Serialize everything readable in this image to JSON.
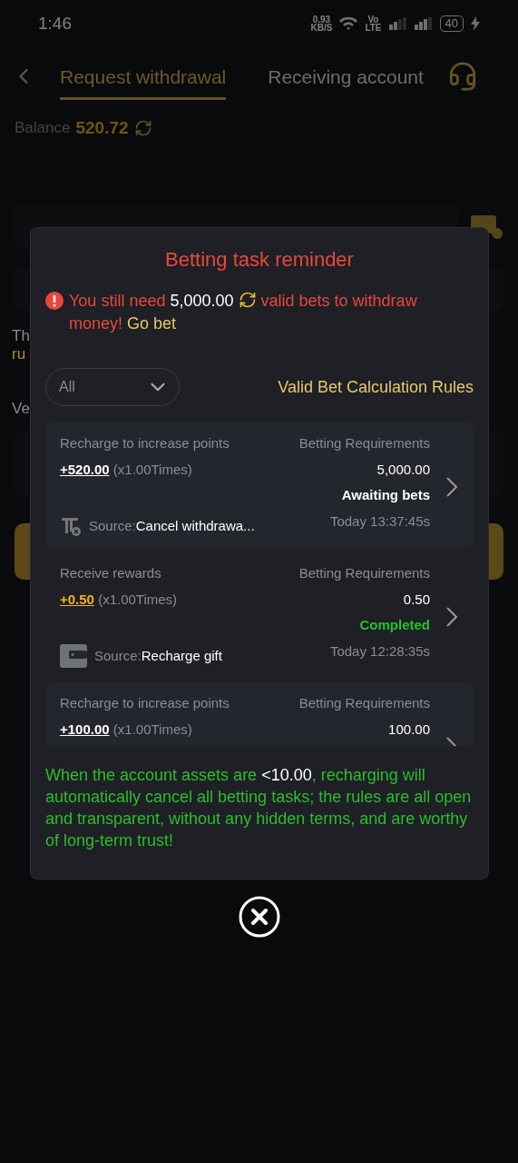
{
  "status_bar": {
    "time": "1:46",
    "net_speed": "0.93",
    "net_unit": "KB/S",
    "volte": [
      "Vo",
      "LTE"
    ],
    "battery": "40"
  },
  "header": {
    "tabs": [
      {
        "label": "Request withdrawal",
        "selected": true
      },
      {
        "label": "Receiving account",
        "selected": false
      }
    ]
  },
  "balance": {
    "label": "Balance",
    "value": "520.72"
  },
  "background_fragments": [
    {
      "text": "Th",
      "kind": "plain"
    },
    {
      "text": "ru",
      "kind": "gold"
    },
    {
      "text": "Ve",
      "kind": "plain"
    }
  ],
  "dialog": {
    "title": "Betting task reminder",
    "notice": {
      "prefix": "You still need",
      "amount": "5,000.00",
      "suffix": "valid bets to withdraw money!",
      "link": "Go bet"
    },
    "filter": {
      "value": "All"
    },
    "rules_link": "Valid Bet Calculation Rules",
    "tasks": [
      {
        "type": "Recharge to increase points",
        "amount": {
          "text": "+520.00",
          "color": "#ffffff"
        },
        "multiplier": "(x1.00Times)",
        "requirement_label": "Betting Requirements",
        "requirement": "5,000.00",
        "status": {
          "text": "Awaiting bets",
          "completed": false
        },
        "source": {
          "kind": "withdrawal",
          "label": "Source:",
          "value": "Cancel withdrawa..."
        },
        "time": "Today 13:37:45s"
      },
      {
        "type": "Receive rewards",
        "amount": {
          "text": "+0.50",
          "color": "#f5b020"
        },
        "multiplier": "(x1.00Times)",
        "requirement_label": "Betting Requirements",
        "requirement": "0.50",
        "status": {
          "text": "Completed",
          "completed": true
        },
        "source": {
          "kind": "wallet",
          "label": "Source:",
          "value": "Recharge gift"
        },
        "time": "Today 12:28:35s"
      },
      {
        "type": "Recharge to increase points",
        "amount": {
          "text": "+100.00",
          "color": "#ffffff"
        },
        "multiplier": "(x1.00Times)",
        "requirement_label": "Betting Requirements",
        "requirement": "100.00"
      }
    ],
    "footer": {
      "before": "When the account assets are",
      "threshold": "<10.00",
      "after": ", recharging will automatically cancel all betting tasks; the rules are all open and transparent, without any hidden terms, and are worthy of long-term trust!"
    }
  }
}
